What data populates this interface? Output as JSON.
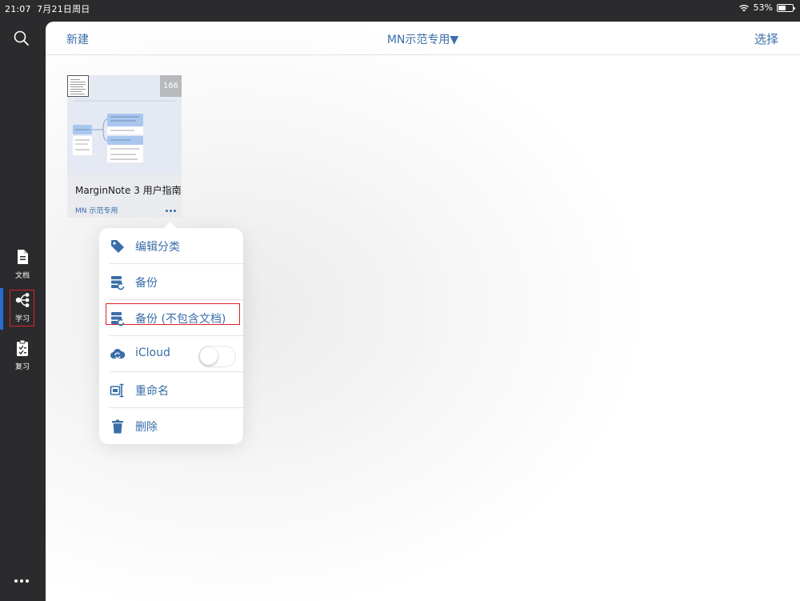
{
  "status_bar": {
    "time": "21:07",
    "date": "7月21日周日",
    "battery_percent": "53%",
    "battery_level": 0.53
  },
  "sidebar": {
    "search_icon": "search-icon",
    "items": [
      {
        "label": "文档",
        "icon": "document-icon"
      },
      {
        "label": "学习",
        "icon": "mindmap-icon",
        "active": true
      },
      {
        "label": "复习",
        "icon": "clipboard-icon"
      }
    ],
    "more_icon": "more-dots-icon"
  },
  "header": {
    "new_label": "新建",
    "title": "MN示范专用▼",
    "select_label": "选择"
  },
  "notebook_card": {
    "name": "MarginNote 3 用户指南",
    "notebook": "MN 示范专用",
    "count": "166"
  },
  "context_menu": {
    "items": [
      {
        "label": "编辑分类",
        "icon": "tag-icon"
      },
      {
        "label": "备份",
        "icon": "backup-icon"
      },
      {
        "label": "备份 (不包含文档)",
        "icon": "backup-icon",
        "highlighted": true
      },
      {
        "label": "iCloud",
        "icon": "cloud-sync-icon",
        "toggle": false
      },
      {
        "label": "重命名",
        "icon": "rename-icon"
      },
      {
        "label": "删除",
        "icon": "trash-icon"
      }
    ]
  },
  "colors": {
    "accent": "#3a6ea8",
    "sidebar_bg": "#2b2b2d",
    "highlight_border": "#e0202a",
    "active_bar": "#2a6bd4"
  }
}
